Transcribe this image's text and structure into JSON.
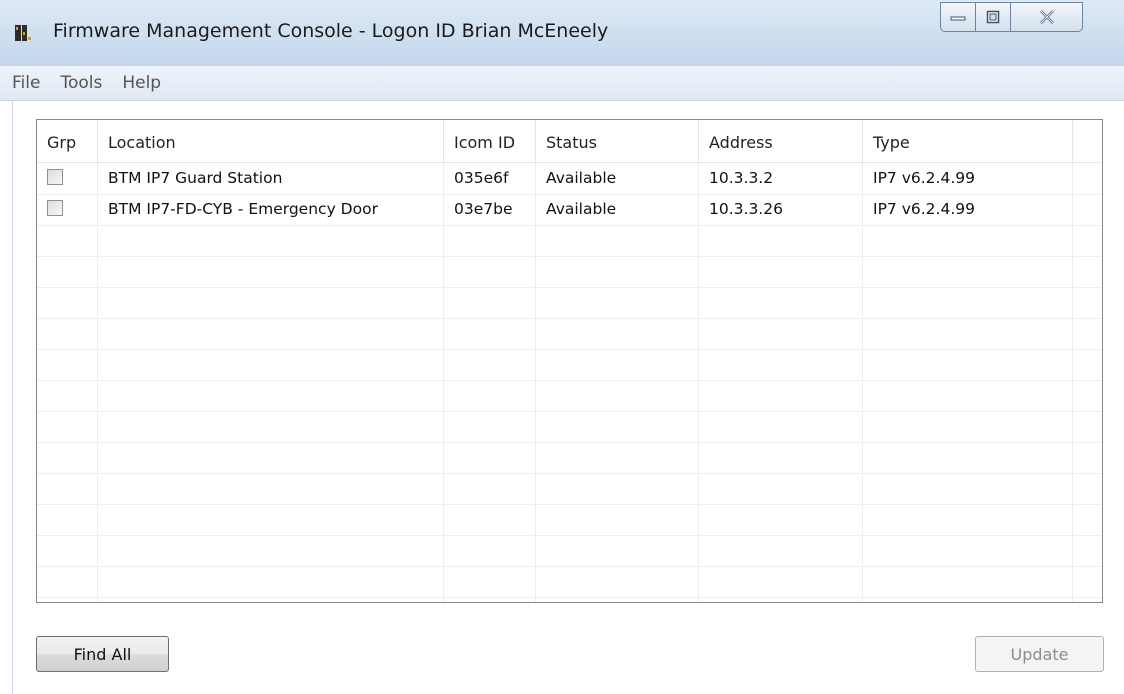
{
  "window": {
    "title": "Firmware Management Console - Logon ID Brian McEneely"
  },
  "menu": {
    "items": [
      {
        "label": "File"
      },
      {
        "label": "Tools"
      },
      {
        "label": "Help"
      }
    ]
  },
  "table": {
    "columns": [
      "Grp",
      "Location",
      "Icom ID",
      "Status",
      "Address",
      "Type"
    ],
    "rows": [
      {
        "grp_checked": false,
        "location": "BTM IP7 Guard Station",
        "icom_id": "035e6f",
        "status": "Available",
        "address": "10.3.3.2",
        "type": "IP7 v6.2.4.99"
      },
      {
        "grp_checked": false,
        "location": "BTM IP7-FD-CYB - Emergency Door",
        "icom_id": "03e7be",
        "status": "Available",
        "address": "10.3.3.26",
        "type": "IP7 v6.2.4.99"
      }
    ]
  },
  "buttons": {
    "find_all": "Find All",
    "update": "Update"
  },
  "colors": {
    "title_bar": "#c4d7ec",
    "window_frame": "#6f84a0",
    "list_border": "#828790"
  }
}
